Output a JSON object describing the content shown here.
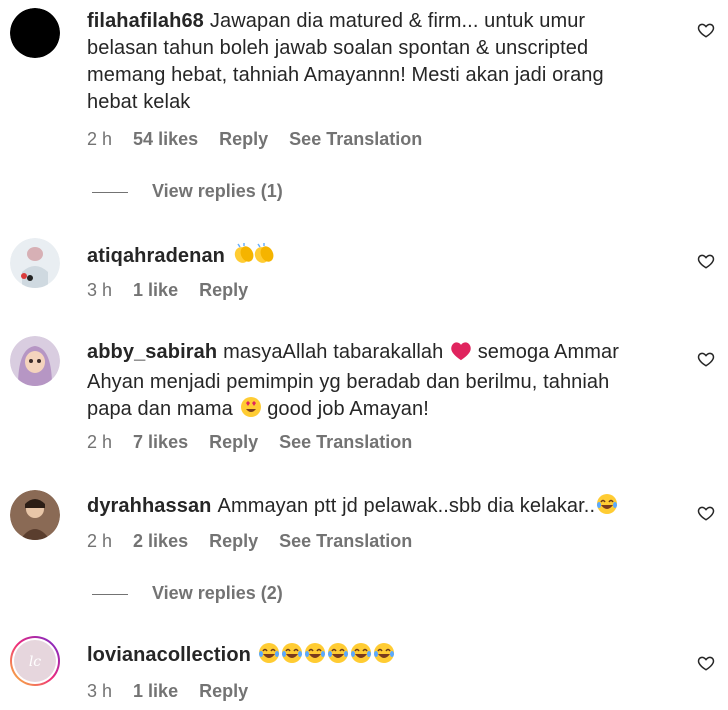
{
  "comments": [
    {
      "username": "filahafilah68",
      "text": "Jawapan dia matured & firm... untuk umur belasan tahun boleh jawab soalan spontan & unscripted memang hebat, tahniah Amayannn! Mesti akan jadi orang hebat kelak",
      "time": "2 h",
      "likes": "54 likes",
      "reply": "Reply",
      "translate": "See Translation",
      "view_replies": "View replies (1)"
    },
    {
      "username": "atiqahradenan",
      "text": "",
      "emoji": "clapping-hands",
      "time": "3 h",
      "likes": "1 like",
      "reply": "Reply"
    },
    {
      "username": "abby_sabirah",
      "text_a": "masyaAllah tabarakallah",
      "text_b": "semoga Ammar Ahyan menjadi pemimpin yg beradab dan berilmu, tahniah papa dan mama",
      "text_c": "good job Amayan!",
      "time": "2 h",
      "likes": "7 likes",
      "reply": "Reply",
      "translate": "See Translation"
    },
    {
      "username": "dyrahhassan",
      "text": "Ammayan ptt jd pelawak..sbb dia kelakar..",
      "time": "2 h",
      "likes": "2 likes",
      "reply": "Reply",
      "translate": "See Translation",
      "view_replies": "View replies (2)"
    },
    {
      "username": "lovianacollection",
      "text": "",
      "emoji": "tears-of-joy x6",
      "time": "3 h",
      "likes": "1 like",
      "reply": "Reply"
    }
  ],
  "colors": {
    "text": "#262626",
    "secondary": "#737373",
    "heart_emoji": "#e0245e",
    "emoji_yellow": "#ffcc33"
  }
}
